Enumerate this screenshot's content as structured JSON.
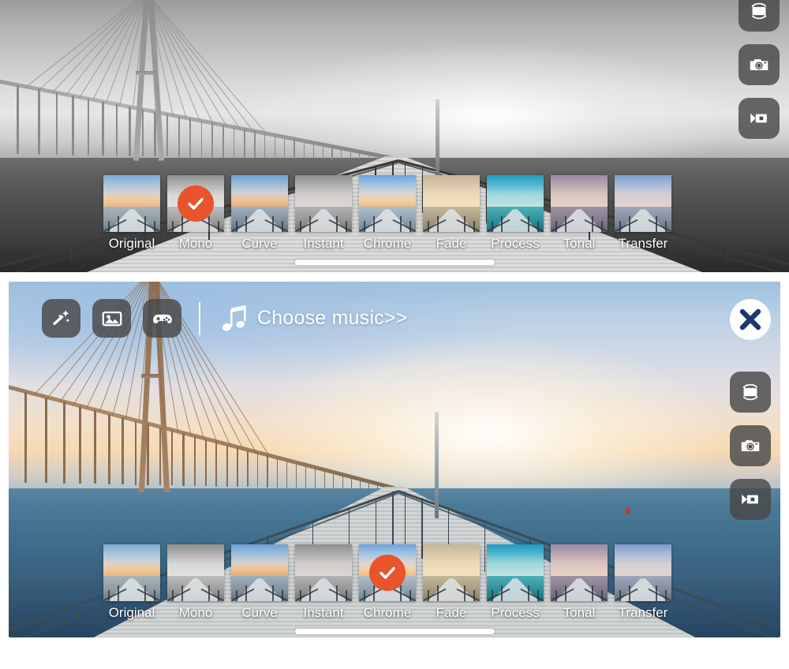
{
  "app": {
    "accent_orange": "#e8542b",
    "toolbar_bg": "#484848",
    "close_x_color": "#1b3a6b"
  },
  "panels": [
    {
      "id": "top",
      "mode": "mono",
      "selected_filter": "Mono",
      "side_toolbar": {
        "has_close": false,
        "buttons": [
          {
            "name": "rotate-icon",
            "label": "Rotate"
          },
          {
            "name": "camera-icon",
            "label": "Camera"
          },
          {
            "name": "video-icon",
            "label": "Video"
          }
        ]
      },
      "edit_bar": null,
      "filters": [
        {
          "label": "Original",
          "selected": false
        },
        {
          "label": "Mono",
          "selected": true
        },
        {
          "label": "Curve",
          "selected": false
        },
        {
          "label": "Instant",
          "selected": false
        },
        {
          "label": "Chrome",
          "selected": false
        },
        {
          "label": "Fade",
          "selected": false
        },
        {
          "label": "Process",
          "selected": false
        },
        {
          "label": "Tonal",
          "selected": false
        },
        {
          "label": "Transfer",
          "selected": false
        }
      ]
    },
    {
      "id": "bottom",
      "mode": "color",
      "selected_filter": "Chrome",
      "side_toolbar": {
        "has_close": true,
        "close_label": "Close",
        "buttons": [
          {
            "name": "rotate-icon",
            "label": "Rotate"
          },
          {
            "name": "camera-icon",
            "label": "Camera"
          },
          {
            "name": "video-icon",
            "label": "Video"
          }
        ]
      },
      "edit_bar": {
        "buttons": [
          {
            "name": "magic-wand-icon",
            "label": "Effects"
          },
          {
            "name": "image-icon",
            "label": "Sticker"
          },
          {
            "name": "gamepad-icon",
            "label": "Game"
          }
        ],
        "music": {
          "icon": "music-note-icon",
          "text": "Choose music>>"
        }
      },
      "filters": [
        {
          "label": "Original",
          "selected": false
        },
        {
          "label": "Mono",
          "selected": false
        },
        {
          "label": "Curve",
          "selected": false
        },
        {
          "label": "Instant",
          "selected": false
        },
        {
          "label": "Chrome",
          "selected": true
        },
        {
          "label": "Fade",
          "selected": false
        },
        {
          "label": "Process",
          "selected": false
        },
        {
          "label": "Tonal",
          "selected": false
        },
        {
          "label": "Transfer",
          "selected": false
        }
      ]
    }
  ],
  "filter_thumb_styles": {
    "Original": {
      "sky": "linear-gradient(180deg,#7fa9d4 0%,#a9c4dd 30%,#d8d2cd 58%,#f3c89a 80%,#e7b887 100%)",
      "sea": "linear-gradient(180deg,#a9b4bb 0%,#8e9aa3 55%,#6d7880 100%)"
    },
    "Mono": {
      "sky": "linear-gradient(180deg,#8f8f8f 0%,#b4b4b4 32%,#d6d6d6 62%,#e2e2e2 100%)",
      "sea": "linear-gradient(180deg,#bdbdbd 0%,#9d9d9d 55%,#787878 100%)"
    },
    "Curve": {
      "sky": "linear-gradient(180deg,#6f9fd2 0%,#9dbedb 30%,#d5d0cd 58%,#f1c294 80%,#e4ae7c 100%)",
      "sea": "linear-gradient(180deg,#9fb0bd 0%,#83919e 55%,#626f7b 100%)"
    },
    "Instant": {
      "sky": "linear-gradient(180deg,#8e8e8e 0%,#aeaeae 30%,#cfcccb 60%,#ded7d2 100%)",
      "sea": "linear-gradient(180deg,#b3b3b3 0%,#949494 55%,#737373 100%)"
    },
    "Chrome": {
      "sky": "linear-gradient(180deg,#6aa3da 0%,#9fc3e3 28%,#dad6d3 58%,#f6cfa2 80%,#ecba86 100%)",
      "sea": "linear-gradient(180deg,#aebfcb 0%,#8ea0ae 55%,#6c7e8c 100%)"
    },
    "Fade": {
      "sky": "linear-gradient(180deg,#c4b49a 0%,#d9c6a8 30%,#ecd9b6 60%,#f3e2c2 100%)",
      "sea": "linear-gradient(180deg,#c3b79c 0%,#a79a80 55%,#8a7f68 100%)"
    },
    "Process": {
      "sky": "linear-gradient(180deg,#1f9bbf 0%,#4fb8cf 30%,#9fd6dc 60%,#c6e4e2 100%)",
      "sea": "linear-gradient(180deg,#4fb0b8 0%,#2e8f9b 55%,#1d6f7c 100%)"
    },
    "Tonal": {
      "sky": "linear-gradient(180deg,#9a8aa6 0%,#b9a6ae 30%,#d8c4bd 60%,#e8d2c4 100%)",
      "sea": "linear-gradient(180deg,#9d93a4 0%,#827a8c 55%,#665f71 100%)"
    },
    "Transfer": {
      "sky": "linear-gradient(180deg,#7e9cc8 0%,#a5bada 30%,#d2cfd4 60%,#e4d2cd 100%)",
      "sea": "linear-gradient(180deg,#9fa9bb 0%,#838c9e 55%,#646d80 100%)"
    }
  }
}
